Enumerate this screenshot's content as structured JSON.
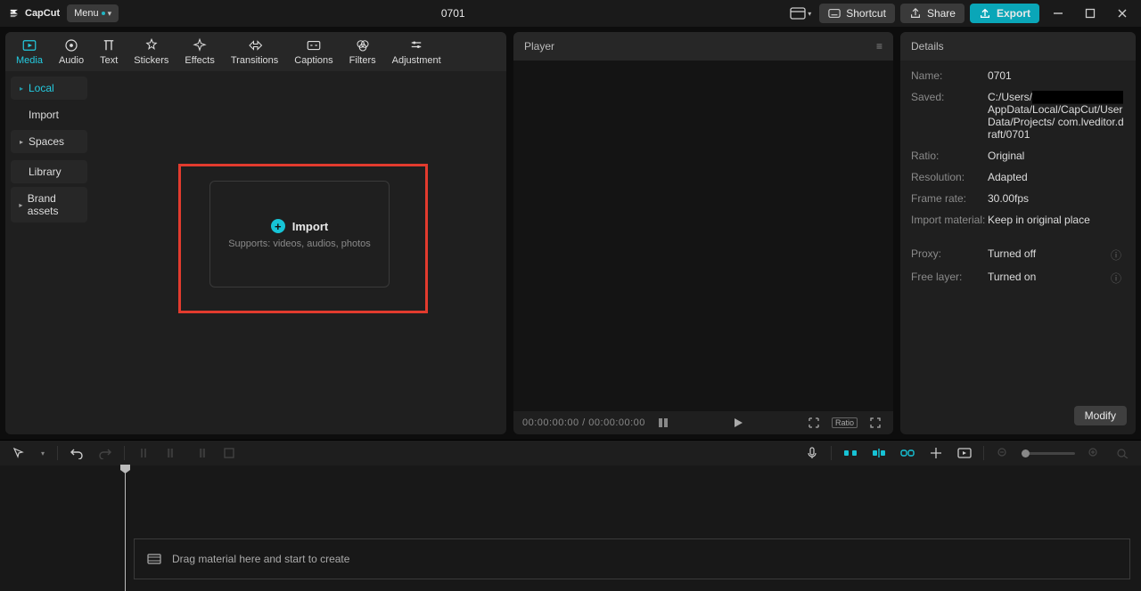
{
  "app": {
    "name": "CapCut",
    "menu_label": "Menu",
    "project_title": "0701"
  },
  "top_buttons": {
    "shortcut": "Shortcut",
    "share": "Share",
    "export": "Export"
  },
  "categories": [
    {
      "id": "media",
      "label": "Media"
    },
    {
      "id": "audio",
      "label": "Audio"
    },
    {
      "id": "text",
      "label": "Text"
    },
    {
      "id": "stickers",
      "label": "Stickers"
    },
    {
      "id": "effects",
      "label": "Effects"
    },
    {
      "id": "transitions",
      "label": "Transitions"
    },
    {
      "id": "captions",
      "label": "Captions"
    },
    {
      "id": "filters",
      "label": "Filters"
    },
    {
      "id": "adjustment",
      "label": "Adjustment"
    }
  ],
  "media_sidebar": [
    {
      "id": "local",
      "label": "Local",
      "expandable": true,
      "active": true
    },
    {
      "id": "import",
      "label": "Import",
      "expandable": false,
      "active": false
    },
    {
      "id": "spaces",
      "label": "Spaces",
      "expandable": true,
      "active": false
    },
    {
      "id": "library",
      "label": "Library",
      "expandable": false,
      "active": false
    },
    {
      "id": "brand",
      "label": "Brand assets",
      "expandable": true,
      "active": false
    }
  ],
  "import_card": {
    "label": "Import",
    "sub": "Supports: videos, audios, photos"
  },
  "player": {
    "title": "Player",
    "time_current": "00:00:00:00",
    "time_total": "00:00:00:00",
    "ratio_badge": "Ratio"
  },
  "details": {
    "title": "Details",
    "rows": {
      "name": {
        "k": "Name:",
        "v": "0701"
      },
      "saved": {
        "k": "Saved:",
        "v_prefix": "C:/Users/",
        "v_hidden": "████████████",
        "v_suffix": "AppData/Local/CapCut/User Data/Projects/ com.lveditor.draft/0701"
      },
      "ratio": {
        "k": "Ratio:",
        "v": "Original"
      },
      "resolution": {
        "k": "Resolution:",
        "v": "Adapted"
      },
      "framerate": {
        "k": "Frame rate:",
        "v": "30.00fps"
      },
      "material": {
        "k": "Import material:",
        "v": "Keep in original place"
      },
      "proxy": {
        "k": "Proxy:",
        "v": "Turned off"
      },
      "freelayer": {
        "k": "Free layer:",
        "v": "Turned on"
      }
    },
    "modify": "Modify"
  },
  "timeline": {
    "drop_hint": "Drag material here and start to create"
  }
}
